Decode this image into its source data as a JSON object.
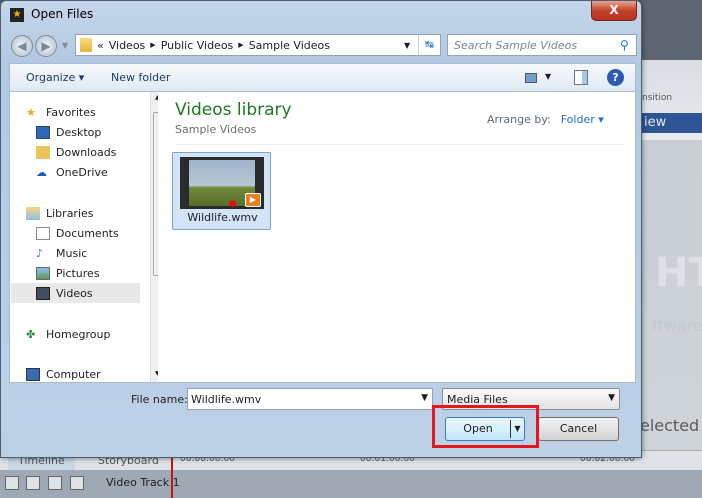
{
  "background_app": {
    "ribbon_label": "nsition",
    "ribbon_tab": "iew",
    "watermark": "HT",
    "brand_text": "ftware",
    "status_text": "elected",
    "tabs": [
      "Timeline",
      "Storyboard"
    ],
    "track_name": "Video Track 1",
    "timecodes": [
      "00:00:00:00",
      "00:01:00:00",
      "00:02:00:00"
    ]
  },
  "dialog": {
    "title": "Open Files",
    "close_label": "X",
    "address": {
      "prefix": "«",
      "segments": [
        "Videos",
        "Public Videos",
        "Sample Videos"
      ]
    },
    "search": {
      "placeholder": "Search Sample Videos"
    },
    "toolbar": {
      "organize": "Organize ▾",
      "new_folder": "New folder"
    },
    "nav": {
      "items": [
        {
          "label": "Favorites",
          "icon": "star-icon"
        },
        {
          "label": "Desktop",
          "icon": "desktop-icon"
        },
        {
          "label": "Downloads",
          "icon": "downloads-icon"
        },
        {
          "label": "OneDrive",
          "icon": "cloud-icon"
        },
        {
          "label": "Libraries",
          "icon": "libraries-icon"
        },
        {
          "label": "Documents",
          "icon": "document-icon"
        },
        {
          "label": "Music",
          "icon": "music-icon"
        },
        {
          "label": "Pictures",
          "icon": "pictures-icon"
        },
        {
          "label": "Videos",
          "icon": "videos-icon",
          "selected": true
        },
        {
          "label": "Homegroup",
          "icon": "homegroup-icon"
        },
        {
          "label": "Computer",
          "icon": "computer-icon"
        }
      ]
    },
    "library": {
      "title": "Videos library",
      "subtitle": "Sample Videos",
      "arrange_label": "Arrange by:",
      "arrange_value": "Folder ▾"
    },
    "files": [
      {
        "name": "Wildlife.wmv",
        "selected": true
      }
    ],
    "file_name_label": "File name:",
    "file_name_value": "Wildlife.wmv",
    "file_type": "Media Files",
    "open_label": "Open",
    "cancel_label": "Cancel"
  },
  "colors": {
    "highlight": "#e5161e",
    "library_title": "#1e7a1e",
    "link": "#1e6fc6"
  }
}
